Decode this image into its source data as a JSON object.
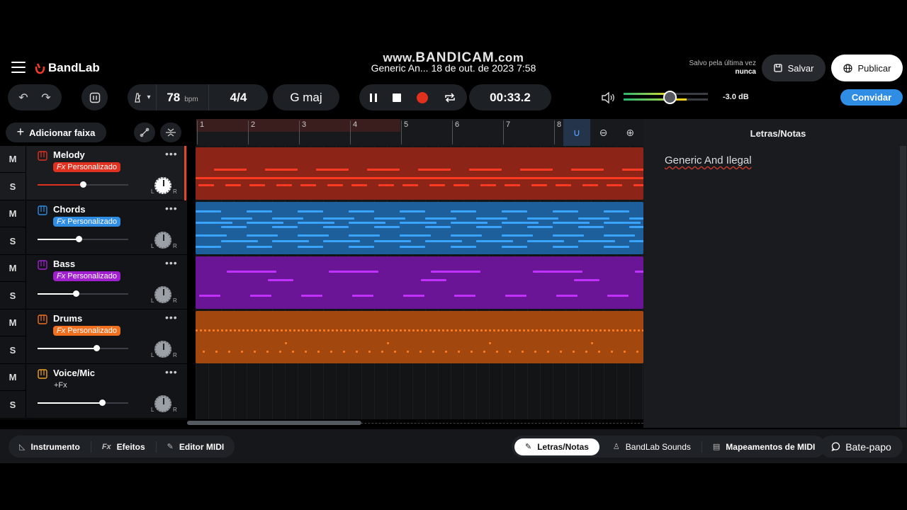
{
  "watermark": {
    "title_prefix": "www.",
    "title_brand": "BANDICAM",
    "title_suffix": ".com",
    "subtitle": "Generic An... 18 de out. de 2023 7:58"
  },
  "header": {
    "logo_text": "BandLab",
    "saved_label": "Salvo pela última vez",
    "saved_value": "nunca",
    "save_label": "Salvar",
    "publish_label": "Publicar",
    "invite_label": "Convidar"
  },
  "transport": {
    "tempo": "78",
    "tempo_unit": "bpm",
    "time_signature": "4/4",
    "key": "G maj",
    "time": "00:33.2",
    "master_volume_db": "-3.0 dB",
    "master_volume_level": 0.55
  },
  "toolbar": {
    "add_track_label": "Adicionar faixa"
  },
  "ruler": {
    "bars": [
      "1",
      "2",
      "3",
      "4",
      "5",
      "6",
      "7",
      "8"
    ],
    "loop_bars": [
      1,
      5
    ]
  },
  "tracks": [
    {
      "name": "Melody",
      "fx": "Personalizado",
      "fx_prefix": "Fx",
      "color": "#e0301e",
      "volume": 0.5,
      "icon": "keyboard-icon",
      "mute": "M",
      "solo": "S",
      "pan_l": "L",
      "pan_r": "R"
    },
    {
      "name": "Chords",
      "fx": "Personalizado",
      "fx_prefix": "Fx",
      "color": "#2f8de4",
      "volume": 0.45,
      "icon": "wave-icon",
      "mute": "M",
      "solo": "S",
      "pan_l": "L",
      "pan_r": "R"
    },
    {
      "name": "Bass",
      "fx": "Personalizado",
      "fx_prefix": "Fx",
      "color": "#a020d0",
      "volume": 0.42,
      "icon": "synth-icon",
      "mute": "M",
      "solo": "S",
      "pan_l": "L",
      "pan_r": "R"
    },
    {
      "name": "Drums",
      "fx": "Personalizado",
      "fx_prefix": "Fx",
      "color": "#f07020",
      "volume": 0.65,
      "icon": "drum-pad-icon",
      "mute": "M",
      "solo": "S",
      "pan_l": "L",
      "pan_r": "R"
    },
    {
      "name": "Voice/Mic",
      "fx": "+Fx",
      "color": "#f0a020",
      "volume": 0.71,
      "icon": "microphone-icon",
      "mute": "M",
      "solo": "S",
      "pan_l": "L",
      "pan_r": "R"
    }
  ],
  "notes_panel": {
    "title": "Letras/Notas",
    "text": "Generic And Ilegal"
  },
  "bottom": {
    "left_tabs": [
      "Instrumento",
      "Efeitos",
      "Editor MIDI"
    ],
    "right_tabs": [
      "Letras/Notas",
      "BandLab Sounds",
      "Mapeamentos de MIDI"
    ],
    "chat_label": "Bate-papo"
  },
  "colors": {
    "accent_blue": "#2f8de4",
    "record_red": "#e0301e",
    "bg": "#121416"
  }
}
